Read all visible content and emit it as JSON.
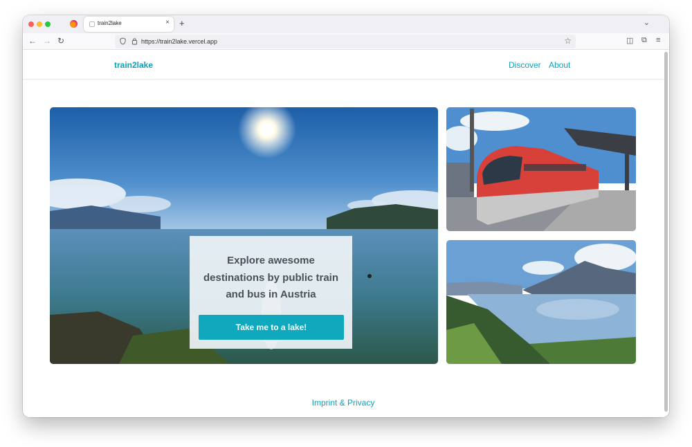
{
  "browser": {
    "tab_title": "train2lake",
    "tab_close": "×",
    "new_tab": "+",
    "tab_list": "⌄",
    "url": "https://train2lake.vercel.app",
    "back": "←",
    "forward": "→",
    "reload": "↻",
    "bookmark": "☆",
    "pocket": "◫",
    "extensions": "⧉",
    "menu": "≡"
  },
  "site": {
    "brand": "train2lake",
    "nav": [
      {
        "label": "Discover"
      },
      {
        "label": "About"
      }
    ],
    "hero": {
      "heading": "Explore awesome destinations by public train and bus in Austria",
      "cta": "Take me to a lake!"
    },
    "footer": {
      "link": "Imprint & Privacy"
    }
  },
  "colors": {
    "accent": "#0e9fb6",
    "cta_bg": "#0fa8bd"
  }
}
